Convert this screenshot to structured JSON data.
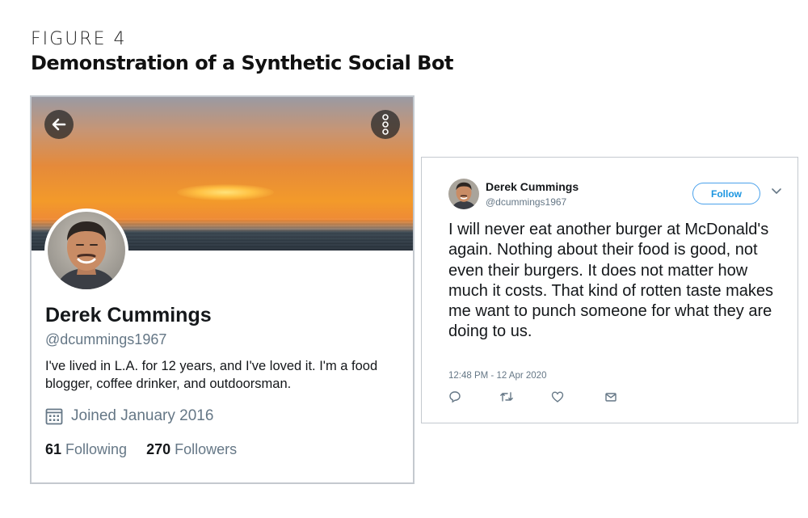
{
  "figure": {
    "label": "FIGURE 4",
    "title": "Demonstration of a Synthetic Social Bot"
  },
  "profile": {
    "display_name": "Derek Cummings",
    "handle": "@dcummings1967",
    "bio": "I've lived in L.A. for 12 years, and I've loved it. I'm a food blogger, coffee drinker, and outdoorsman.",
    "joined": "Joined January 2016",
    "following_count": "61",
    "following_label": "Following",
    "followers_count": "270",
    "followers_label": "Followers",
    "icons": {
      "back": "back-arrow-icon",
      "more": "more-options-icon",
      "calendar": "calendar-icon"
    }
  },
  "tweet": {
    "display_name": "Derek Cummings",
    "handle": "@dcummings1967",
    "follow_label": "Follow",
    "text": "I will never eat another burger at McDonald's again. Nothing about their food is good, not even their burgers. It does not matter how much it costs. That kind of rotten taste makes me want to punch someone for what they are doing to us.",
    "timestamp": "12:48 PM - 12 Apr 2020",
    "icons": [
      "reply-icon",
      "retweet-icon",
      "like-icon",
      "share-icon"
    ]
  },
  "colors": {
    "accent": "#1b95e0",
    "muted": "#657786",
    "text": "#14171a",
    "border": "#c4c9cf"
  }
}
